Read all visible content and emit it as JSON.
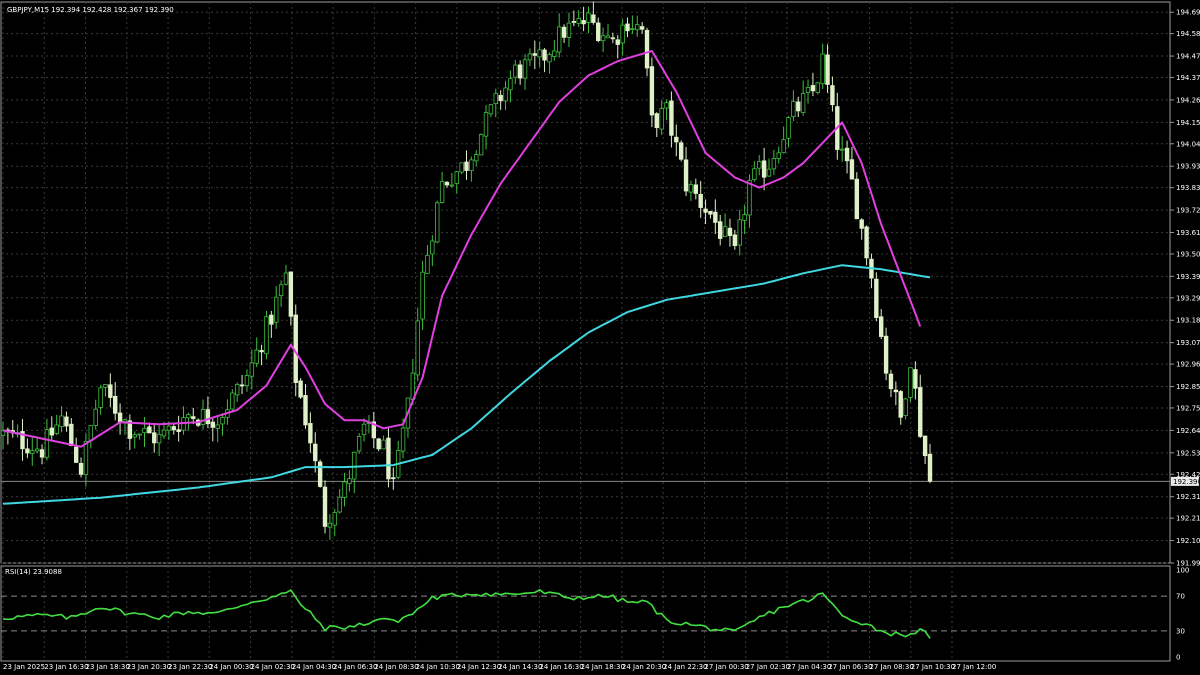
{
  "chart_data": {
    "type": "candlestick",
    "symbol_header": "GBPJPY,M15  192.394 192.428 192.367 192.390",
    "colors": {
      "background": "#000000",
      "grid": "#3a3a3a",
      "bull": "#3fbf3f",
      "bear": "#e0f0c8",
      "ma_fast": "#e040e0",
      "ma_slow": "#40d8e0",
      "rsi": "#40e040",
      "text": "#ffffff"
    },
    "price_axis": {
      "ticks": [
        "194.690",
        "194.585",
        "194.475",
        "194.370",
        "194.260",
        "194.150",
        "194.045",
        "193.935",
        "193.830",
        "193.720",
        "193.610",
        "193.505",
        "193.395",
        "193.290",
        "193.180",
        "193.070",
        "192.965",
        "192.855",
        "192.750",
        "192.640",
        "192.530",
        "192.425",
        "192.315",
        "192.210",
        "192.100",
        "191.990"
      ],
      "range": [
        191.99,
        194.74
      ],
      "current_price": "192.390"
    },
    "time_axis": {
      "labels": [
        "23 Jan 2025",
        "23 Jan 16:30",
        "23 Jan 18:30",
        "23 Jan 20:30",
        "23 Jan 22:30",
        "24 Jan 00:30",
        "24 Jan 02:30",
        "24 Jan 04:30",
        "24 Jan 06:30",
        "24 Jan 08:30",
        "24 Jan 10:30",
        "24 Jan 12:30",
        "24 Jan 14:30",
        "24 Jan 16:30",
        "24 Jan 18:30",
        "24 Jan 20:30",
        "24 Jan 22:30",
        "27 Jan 00:30",
        "27 Jan 02:30",
        "27 Jan 04:30",
        "27 Jan 06:30",
        "27 Jan 08:30",
        "27 Jan 10:30",
        "27 Jan 12:00"
      ]
    },
    "close_keypoints": [
      [
        0,
        192.62
      ],
      [
        8,
        192.55
      ],
      [
        12,
        192.7
      ],
      [
        16,
        192.45
      ],
      [
        20,
        192.85
      ],
      [
        26,
        192.65
      ],
      [
        32,
        192.6
      ],
      [
        38,
        192.72
      ],
      [
        44,
        192.7
      ],
      [
        50,
        192.9
      ],
      [
        55,
        193.2
      ],
      [
        58,
        193.4
      ],
      [
        60,
        192.9
      ],
      [
        63,
        192.6
      ],
      [
        66,
        192.2
      ],
      [
        70,
        192.35
      ],
      [
        74,
        192.65
      ],
      [
        78,
        192.55
      ],
      [
        80,
        192.35
      ],
      [
        83,
        192.75
      ],
      [
        86,
        193.4
      ],
      [
        90,
        193.85
      ],
      [
        95,
        193.95
      ],
      [
        100,
        194.2
      ],
      [
        105,
        194.4
      ],
      [
        110,
        194.45
      ],
      [
        115,
        194.6
      ],
      [
        120,
        194.65
      ],
      [
        125,
        194.55
      ],
      [
        128,
        194.65
      ],
      [
        131,
        194.6
      ],
      [
        133,
        194.15
      ],
      [
        136,
        194.2
      ],
      [
        140,
        193.85
      ],
      [
        145,
        193.7
      ],
      [
        150,
        193.5
      ],
      [
        153,
        193.85
      ],
      [
        157,
        193.95
      ],
      [
        162,
        194.2
      ],
      [
        166,
        194.3
      ],
      [
        168,
        194.45
      ],
      [
        171,
        194.05
      ],
      [
        174,
        193.85
      ],
      [
        178,
        193.4
      ],
      [
        181,
        192.95
      ],
      [
        184,
        192.7
      ],
      [
        186,
        193.0
      ],
      [
        188,
        192.65
      ],
      [
        190,
        192.39
      ]
    ],
    "ma_fast_keypoints": [
      [
        0,
        192.64
      ],
      [
        8,
        192.6
      ],
      [
        16,
        192.56
      ],
      [
        24,
        192.68
      ],
      [
        32,
        192.67
      ],
      [
        40,
        192.68
      ],
      [
        48,
        192.74
      ],
      [
        54,
        192.86
      ],
      [
        59,
        193.06
      ],
      [
        62,
        192.95
      ],
      [
        66,
        192.77
      ],
      [
        70,
        192.69
      ],
      [
        74,
        192.69
      ],
      [
        78,
        192.65
      ],
      [
        82,
        192.67
      ],
      [
        86,
        192.9
      ],
      [
        90,
        193.3
      ],
      [
        96,
        193.6
      ],
      [
        102,
        193.85
      ],
      [
        108,
        194.05
      ],
      [
        114,
        194.25
      ],
      [
        120,
        194.38
      ],
      [
        126,
        194.45
      ],
      [
        133,
        194.5
      ],
      [
        138,
        194.3
      ],
      [
        144,
        194.0
      ],
      [
        150,
        193.88
      ],
      [
        155,
        193.83
      ],
      [
        160,
        193.88
      ],
      [
        164,
        193.95
      ],
      [
        168,
        194.05
      ],
      [
        172,
        194.15
      ],
      [
        176,
        193.95
      ],
      [
        180,
        193.65
      ],
      [
        184,
        193.4
      ],
      [
        188,
        193.15
      ]
    ],
    "ma_slow_keypoints": [
      [
        0,
        192.28
      ],
      [
        20,
        192.31
      ],
      [
        40,
        192.36
      ],
      [
        55,
        192.41
      ],
      [
        62,
        192.46
      ],
      [
        70,
        192.46
      ],
      [
        80,
        192.47
      ],
      [
        88,
        192.52
      ],
      [
        96,
        192.65
      ],
      [
        104,
        192.82
      ],
      [
        112,
        192.98
      ],
      [
        120,
        193.12
      ],
      [
        128,
        193.22
      ],
      [
        136,
        193.28
      ],
      [
        146,
        193.32
      ],
      [
        156,
        193.36
      ],
      [
        164,
        193.41
      ],
      [
        172,
        193.45
      ],
      [
        180,
        193.43
      ],
      [
        190,
        193.39
      ]
    ],
    "rsi": {
      "label": "RSI(14) 23.9088",
      "levels": [
        "70",
        "30"
      ],
      "axis_labels": [
        "100",
        "70",
        "30",
        "0"
      ],
      "range": [
        0,
        100
      ],
      "keypoints": [
        [
          0,
          45
        ],
        [
          8,
          48
        ],
        [
          14,
          45
        ],
        [
          20,
          58
        ],
        [
          26,
          50
        ],
        [
          32,
          46
        ],
        [
          38,
          52
        ],
        [
          44,
          50
        ],
        [
          50,
          62
        ],
        [
          56,
          70
        ],
        [
          59,
          75
        ],
        [
          62,
          55
        ],
        [
          66,
          33
        ],
        [
          72,
          35
        ],
        [
          78,
          45
        ],
        [
          80,
          40
        ],
        [
          84,
          50
        ],
        [
          88,
          68
        ],
        [
          96,
          73
        ],
        [
          104,
          72
        ],
        [
          110,
          75
        ],
        [
          116,
          68
        ],
        [
          124,
          70
        ],
        [
          128,
          63
        ],
        [
          132,
          63
        ],
        [
          136,
          42
        ],
        [
          140,
          38
        ],
        [
          146,
          32
        ],
        [
          150,
          28
        ],
        [
          155,
          45
        ],
        [
          160,
          58
        ],
        [
          166,
          67
        ],
        [
          168,
          73
        ],
        [
          172,
          47
        ],
        [
          176,
          40
        ],
        [
          180,
          30
        ],
        [
          184,
          25
        ],
        [
          188,
          30
        ],
        [
          190,
          24
        ]
      ]
    }
  }
}
